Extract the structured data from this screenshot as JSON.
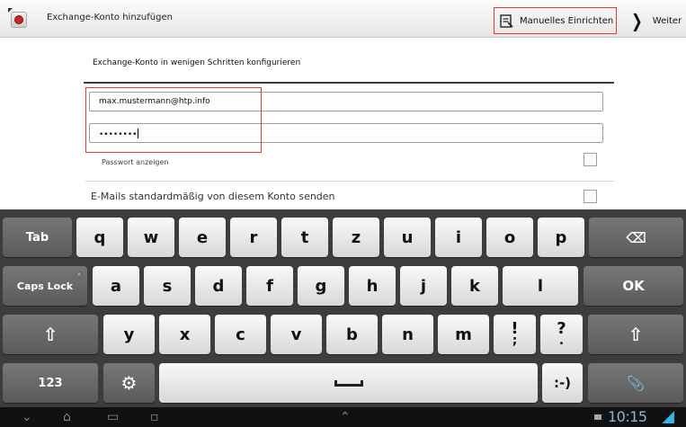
{
  "action_bar": {
    "title": "Exchange-Konto hinzufügen",
    "manual_setup_label": "Manuelles Einrichten",
    "next_label": "Weiter"
  },
  "form": {
    "heading": "Exchange-Konto in wenigen Schritten konfigurieren",
    "email_value": "max.mustermann@htp.info",
    "password_masked": "••••••••",
    "show_password_label": "Passwort anzeigen",
    "show_password_checked": false,
    "default_send_label": "E-Mails standardmäßig von diesem Konto senden",
    "default_send_checked": false
  },
  "keyboard": {
    "row1": [
      "Tab",
      "q",
      "w",
      "e",
      "r",
      "t",
      "z",
      "u",
      "i",
      "o",
      "p",
      "⌫"
    ],
    "row2": [
      "Caps Lock",
      "a",
      "s",
      "d",
      "f",
      "g",
      "h",
      "j",
      "k",
      "l",
      "OK"
    ],
    "row3": [
      "⇧",
      "y",
      "x",
      "c",
      "v",
      "b",
      "n",
      "m",
      "!",
      ";",
      "?",
      ".",
      "⇧"
    ],
    "row4": [
      "123",
      "⚙",
      "␣",
      ":-)",
      "📎"
    ]
  },
  "status_bar": {
    "time": "10:15"
  }
}
